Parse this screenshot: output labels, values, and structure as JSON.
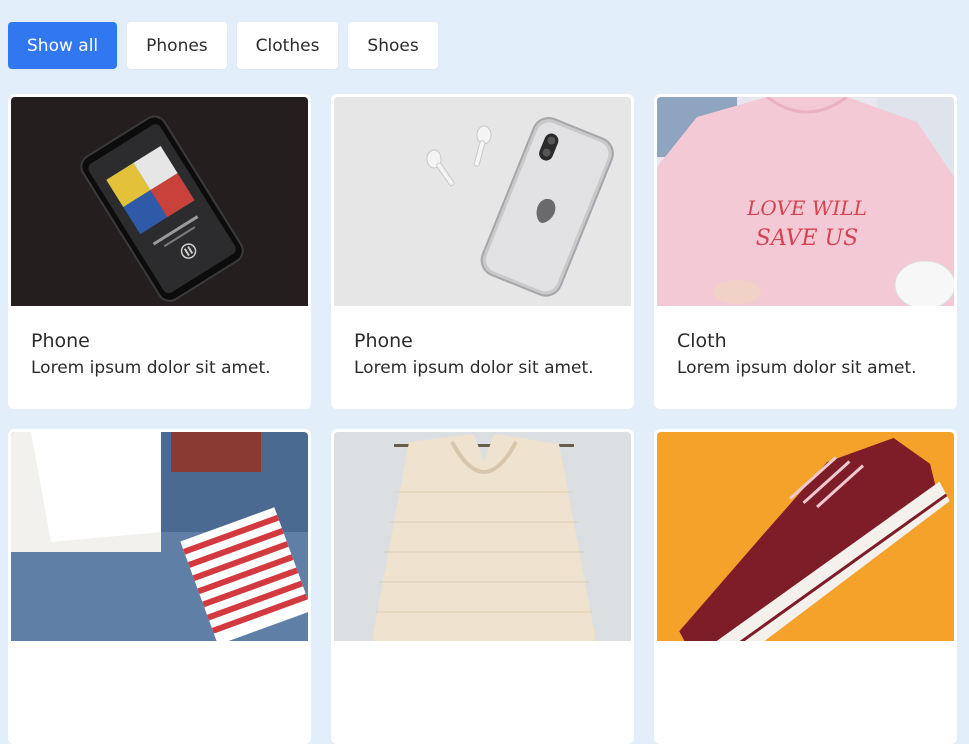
{
  "filters": [
    {
      "label": "Show all",
      "active": true
    },
    {
      "label": "Phones",
      "active": false
    },
    {
      "label": "Clothes",
      "active": false
    },
    {
      "label": "Shoes",
      "active": false
    }
  ],
  "cards": [
    {
      "title": "Phone",
      "desc": "Lorem ipsum dolor sit amet.",
      "image_icon": "phone-dark-photo"
    },
    {
      "title": "Phone",
      "desc": "Lorem ipsum dolor sit amet.",
      "image_icon": "iphone-airpods-photo"
    },
    {
      "title": "Cloth",
      "desc": "Lorem ipsum dolor sit amet.",
      "image_icon": "pink-tshirt-photo",
      "shirt_text_1": "LOVE WILL",
      "shirt_text_2": "SAVE US"
    },
    {
      "image_icon": "folded-clothes-photo"
    },
    {
      "image_icon": "knit-sweater-photo"
    },
    {
      "image_icon": "red-sneaker-photo"
    }
  ],
  "colors": {
    "accent": "#3178f0",
    "page_bg": "#e3eefb"
  }
}
